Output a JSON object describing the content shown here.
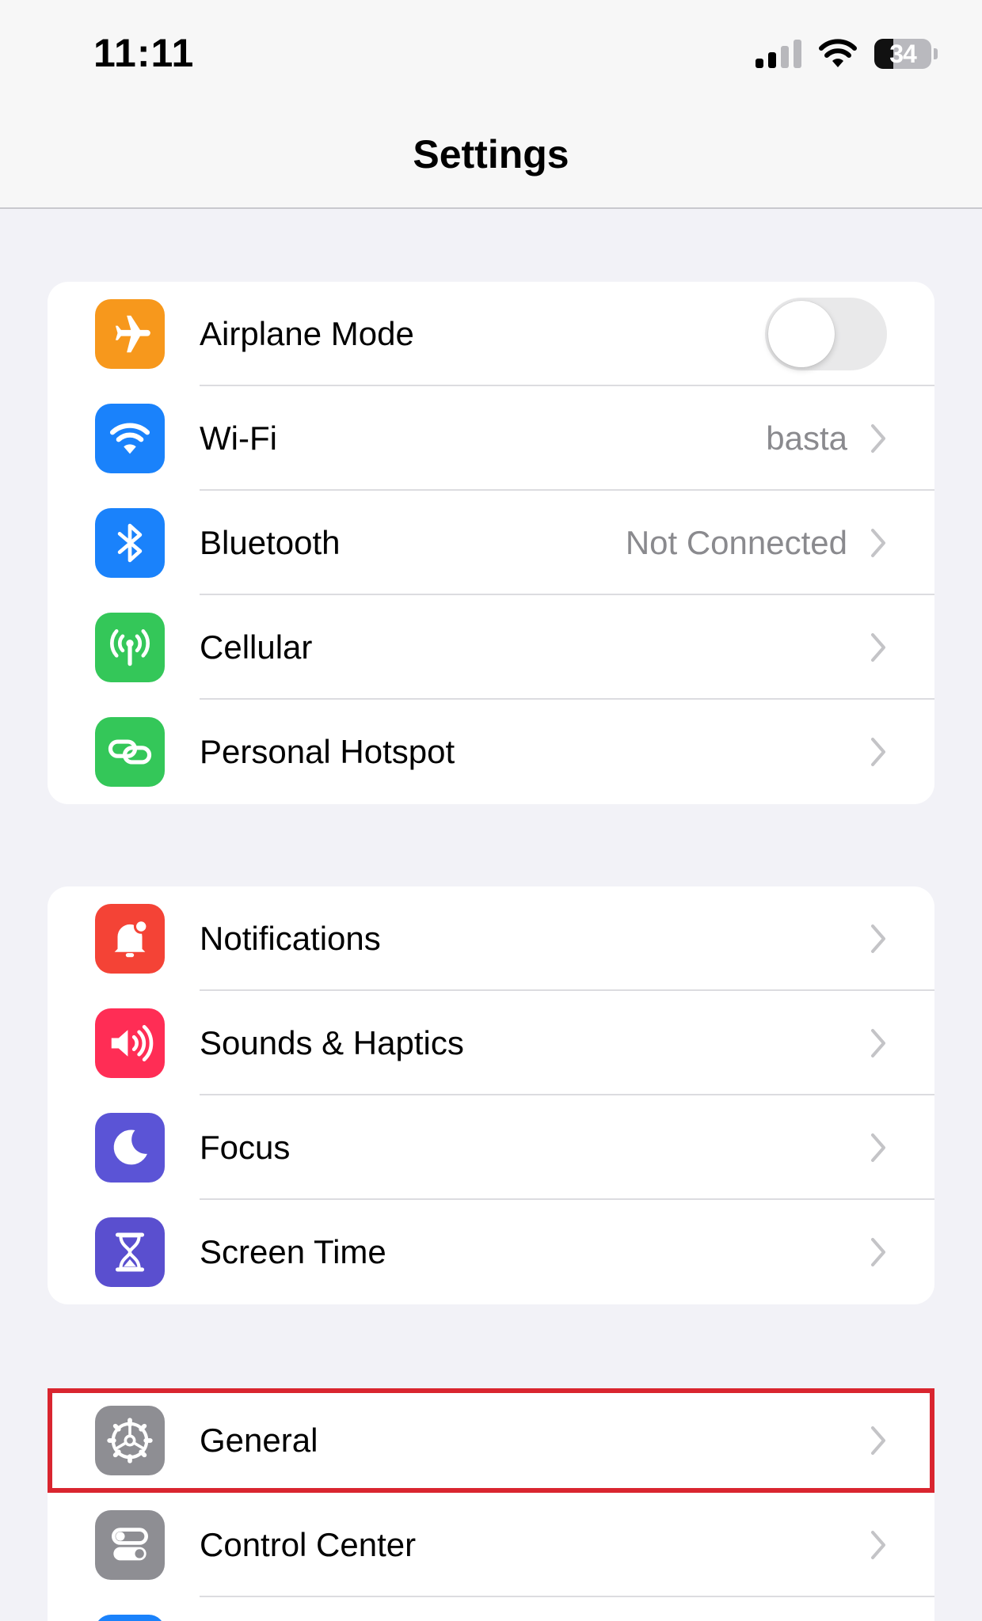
{
  "status_bar": {
    "time": "11:11",
    "battery": "34",
    "battery_level": 0.34
  },
  "header": {
    "title": "Settings"
  },
  "colors": {
    "orange": "#f7981c",
    "blue": "#1a82fb",
    "green": "#34c759",
    "red": "#f44336",
    "pink": "#ff2d55",
    "indigo": "#5b54d6",
    "purple": "#5a4fcf",
    "gray": "#8e8e93",
    "highlight": "#d9252f"
  },
  "groups": [
    {
      "rows": [
        {
          "label": "Airplane Mode",
          "icon": "airplane-icon",
          "toggle": false
        },
        {
          "label": "Wi-Fi",
          "icon": "wifi-icon",
          "value": "basta"
        },
        {
          "label": "Bluetooth",
          "icon": "bluetooth-icon",
          "value": "Not Connected"
        },
        {
          "label": "Cellular",
          "icon": "antenna-icon"
        },
        {
          "label": "Personal Hotspot",
          "icon": "link-icon"
        }
      ]
    },
    {
      "rows": [
        {
          "label": "Notifications",
          "icon": "bell-icon"
        },
        {
          "label": "Sounds & Haptics",
          "icon": "speaker-icon"
        },
        {
          "label": "Focus",
          "icon": "moon-icon"
        },
        {
          "label": "Screen Time",
          "icon": "hourglass-icon"
        }
      ]
    },
    {
      "rows": [
        {
          "label": "General",
          "icon": "gear-icon"
        },
        {
          "label": "Control Center",
          "icon": "switches-icon"
        }
      ]
    }
  ]
}
